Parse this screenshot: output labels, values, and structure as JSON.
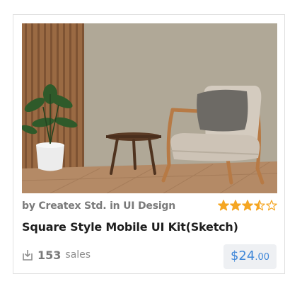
{
  "card": {
    "author_prefix": "by",
    "author": "Createx Std.",
    "category_prefix": "in",
    "category": "UI Design",
    "rating": 3.5,
    "rating_max": 5,
    "title": "Square Style Mobile UI Kit(Sketch)",
    "sales_count": "153",
    "sales_label": "sales",
    "price_main": "$24",
    "price_cents": ".00"
  },
  "icons": {
    "download": "download-icon",
    "star": "star-icon"
  },
  "colors": {
    "star": "#f5a623",
    "price": "#3f87d8",
    "price_bg": "#eef0f3",
    "muted_text": "#7a7a7a"
  }
}
